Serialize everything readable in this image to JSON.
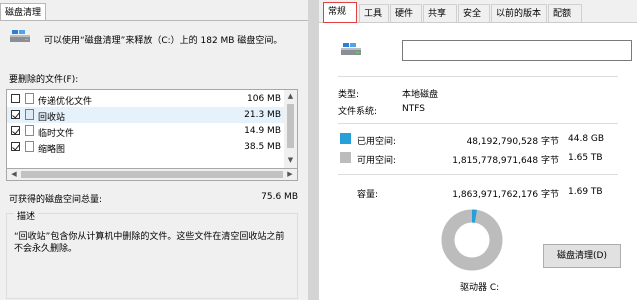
{
  "left": {
    "tab_label": "磁盘清理",
    "info_text": "可以使用“磁盘清理”来释放（C:）上的 182 MB 磁盘空间。",
    "files_label": "要删除的文件(F):",
    "files": [
      {
        "name": "传递优化文件",
        "size": "106 MB",
        "checked": false
      },
      {
        "name": "回收站",
        "size": "21.3 MB",
        "checked": true
      },
      {
        "name": "临时文件",
        "size": "14.9 MB",
        "checked": true
      },
      {
        "name": "缩略图",
        "size": "38.5 MB",
        "checked": true
      }
    ],
    "total_label": "可获得的磁盘空间总量:",
    "total_value": "75.6 MB",
    "desc_title": "描述",
    "desc_line1": "“回收站”包含你从计算机中删除的文件。这些文件在清空回收站之前",
    "desc_line2": "不会永久删除。"
  },
  "right": {
    "tabs": [
      "常规",
      "工具",
      "硬件",
      "共享",
      "安全",
      "以前的版本",
      "配额"
    ],
    "active_tab": 0,
    "name_value": "",
    "type_label": "类型:",
    "type_value": "本地磁盘",
    "fs_label": "文件系统:",
    "fs_value": "NTFS",
    "used_label": "已用空间:",
    "used_bytes": "48,192,790,528 字节",
    "used_size": "44.8 GB",
    "free_label": "可用空间:",
    "free_bytes": "1,815,778,971,648 字节",
    "free_size": "1.65 TB",
    "capacity_label": "容量:",
    "capacity_bytes": "1,863,971,762,176 字节",
    "capacity_size": "1.69 TB",
    "drive_label": "驱动器 C:",
    "cleanup_button": "磁盘清理(D)",
    "used_color": "#26a0da",
    "free_color": "#bcbcbc",
    "used_fraction": 0.026
  }
}
